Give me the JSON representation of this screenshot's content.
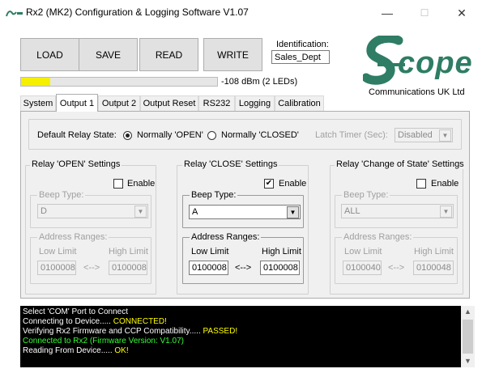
{
  "window": {
    "title": "Rx2 (MK2) Configuration & Logging Software V1.07",
    "controls": {
      "minimize": "—",
      "maximize": "☐",
      "close": "✕"
    }
  },
  "toolbar": {
    "load": "LOAD",
    "save": "SAVE",
    "read": "READ",
    "write": "WRITE"
  },
  "identification": {
    "label": "Identification:",
    "value": "Sales_Dept"
  },
  "signal": {
    "text": "-108 dBm (2 LEDs)",
    "level_fraction": 0.15,
    "bar_color": "#f5ef00"
  },
  "brand": {
    "logo_text": "cope",
    "subtitle": "Communications UK Ltd",
    "color": "#2e7d64"
  },
  "tabs": [
    {
      "label": "System",
      "active": false
    },
    {
      "label": "Output 1",
      "active": true
    },
    {
      "label": "Output 2",
      "active": false
    },
    {
      "label": "Output Reset",
      "active": false
    },
    {
      "label": "RS232",
      "active": false
    },
    {
      "label": "Logging",
      "active": false
    },
    {
      "label": "Calibration",
      "active": false
    }
  ],
  "default_relay": {
    "label": "Default Relay State:",
    "option_open": "Normally 'OPEN'",
    "option_closed": "Normally 'CLOSED'",
    "selected": "open",
    "latch_label": "Latch Timer (Sec):",
    "latch_value": "Disabled"
  },
  "groups": {
    "open": {
      "title": "Relay 'OPEN' Settings",
      "enable_label": "Enable",
      "enabled": false,
      "beep_label": "Beep Type:",
      "beep_value": "D",
      "address_label": "Address Ranges:",
      "low_label": "Low Limit",
      "high_label": "High Limit",
      "low_value": "0100008",
      "arrow": "<-->",
      "high_value": "0100008"
    },
    "close": {
      "title": "Relay 'CLOSE' Settings",
      "enable_label": "Enable",
      "enabled": true,
      "beep_label": "Beep Type:",
      "beep_value": "A",
      "address_label": "Address Ranges:",
      "low_label": "Low Limit",
      "high_label": "High Limit",
      "low_value": "0100008",
      "arrow": "<-->",
      "high_value": "0100008"
    },
    "change": {
      "title": "Relay 'Change of State' Settings",
      "enable_label": "Enable",
      "enabled": false,
      "beep_label": "Beep Type:",
      "beep_value": "ALL",
      "address_label": "Address Ranges:",
      "low_label": "Low Limit",
      "high_label": "High Limit",
      "low_value": "0100040",
      "arrow": "<-->",
      "high_value": "0100048"
    }
  },
  "log": {
    "colors": {
      "white": "#ffffff",
      "yellow": "#ffff00",
      "green": "#33ff33"
    },
    "lines": [
      {
        "prefix": "Select 'COM' Port to Connect",
        "status": "",
        "color": "white"
      },
      {
        "prefix": "Connecting to Device..... ",
        "status": "CONNECTED!",
        "color": "white"
      },
      {
        "prefix": "Verifying Rx2 Firmware and CCP Compatibility..... ",
        "status": "PASSED!",
        "color": "white"
      },
      {
        "prefix": "Connected to Rx2 (Firmware Version: V1.07)",
        "status": "",
        "color": "green"
      },
      {
        "prefix": "Reading From Device..... ",
        "status": "OK!",
        "color": "white"
      }
    ]
  }
}
